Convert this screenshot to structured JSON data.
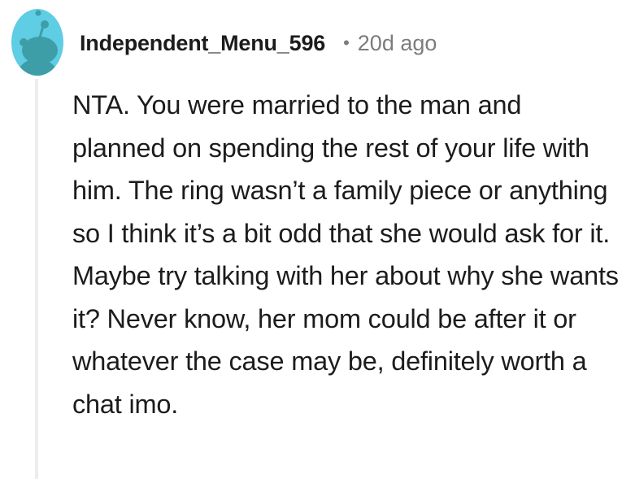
{
  "comment": {
    "avatar_icon": "reddit-snoo-avatar-icon",
    "author": "Independent_Menu_596",
    "separator": "•",
    "age": "20d ago",
    "body": "NTA. You were married to the man and planned on spending the rest of your life with him. The ring wasn’t a family piece or anything so I think it’s a bit odd that she would ask for it. Maybe try talking with her about why she wants it? Never know, her mom could be after it or whatever the case may be, definitely worth a chat imo."
  },
  "colors": {
    "avatar_bg": "#5fcde4",
    "avatar_figure": "#3d9ea8",
    "thread_line": "#ebedef",
    "meta_text": "#7c7c7c",
    "body_text": "#1c1c1c"
  }
}
